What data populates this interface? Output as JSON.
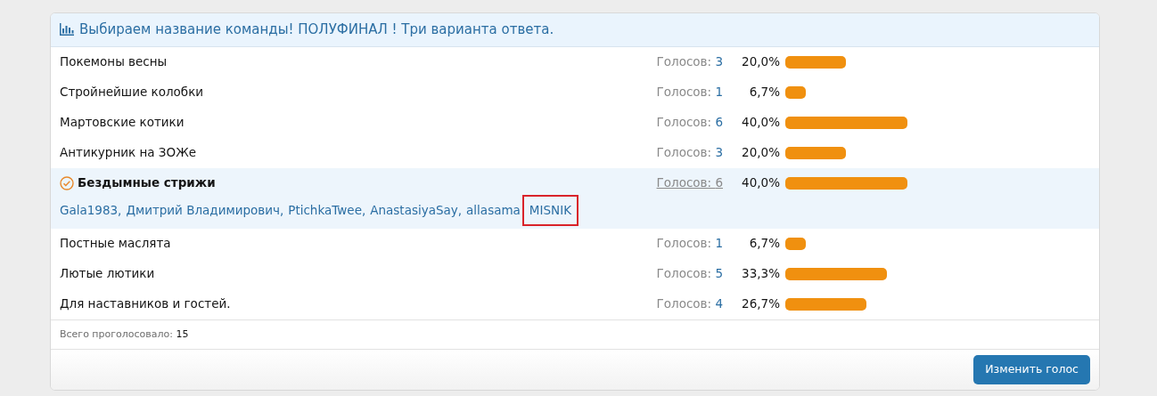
{
  "poll": {
    "title": "Выбираем название команды! ПОЛУФИНАЛ ! Три варианта ответа.",
    "options": [
      {
        "label": "Покемоны весны",
        "votes_label": "Голосов:",
        "votes": "3",
        "percent": "20,0%",
        "voted": false
      },
      {
        "label": "Стройнейшие колобки",
        "votes_label": "Голосов:",
        "votes": "1",
        "percent": "6,7%",
        "voted": false
      },
      {
        "label": "Мартовские котики",
        "votes_label": "Голосов:",
        "votes": "6",
        "percent": "40,0%",
        "voted": false
      },
      {
        "label": "Антикурник на ЗОЖе",
        "votes_label": "Голосов:",
        "votes": "3",
        "percent": "20,0%",
        "voted": false
      },
      {
        "label": "Бездымные стрижи",
        "votes_label": "Голосов:",
        "votes": "6",
        "percent": "40,0%",
        "voted": true,
        "voters": [
          {
            "name": "Gala1983,",
            "highlighted": false
          },
          {
            "name": "Дмитрий Владимирович,",
            "highlighted": false
          },
          {
            "name": "PtichkaTwee,",
            "highlighted": false
          },
          {
            "name": "AnastasiyaSay,",
            "highlighted": false
          },
          {
            "name": "allasama",
            "highlighted": false
          },
          {
            "name": "MISNIK",
            "highlighted": true
          }
        ]
      },
      {
        "label": "Постные маслята",
        "votes_label": "Голосов:",
        "votes": "1",
        "percent": "6,7%",
        "voted": false
      },
      {
        "label": "Лютые лютики",
        "votes_label": "Голосов:",
        "votes": "5",
        "percent": "33,3%",
        "voted": false
      },
      {
        "label": "Для наставников и гостей.",
        "votes_label": "Голосов:",
        "votes": "4",
        "percent": "26,7%",
        "voted": false
      }
    ],
    "total_label": "Всего проголосовало:",
    "total": "15",
    "button": "Изменить голос"
  }
}
